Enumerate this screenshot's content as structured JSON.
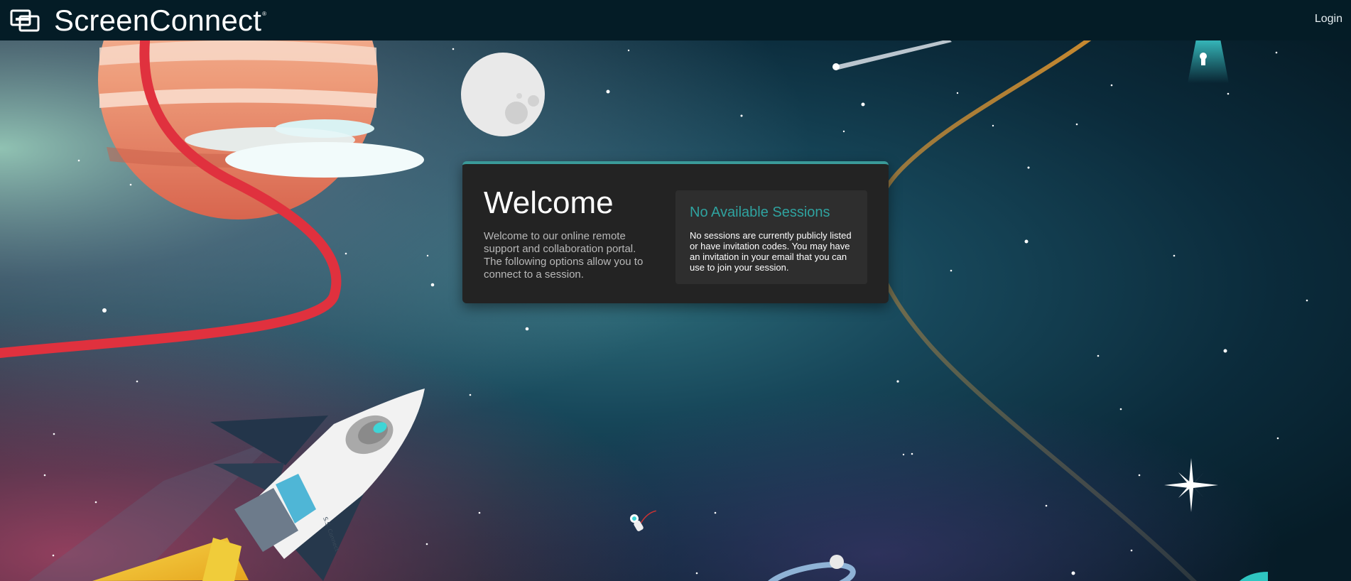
{
  "header": {
    "brand_name": "ScreenConnect",
    "brand_mark": "®",
    "login_label": "Login"
  },
  "welcome": {
    "title": "Welcome",
    "description": "Welcome to our online remote support and collaboration portal. The following options allow you to connect to a session."
  },
  "sessions": {
    "title": "No Available Sessions",
    "message": "No sessions are currently publicly listed or have invitation codes. You may have an invitation in your email that you can use to join your session."
  },
  "illustration": {
    "rocket_label": "S.S. Connect"
  },
  "colors": {
    "topbar": "#041c26",
    "accent": "#2fa3a0",
    "panel": "#232323",
    "session_box": "#2e2e2e"
  }
}
